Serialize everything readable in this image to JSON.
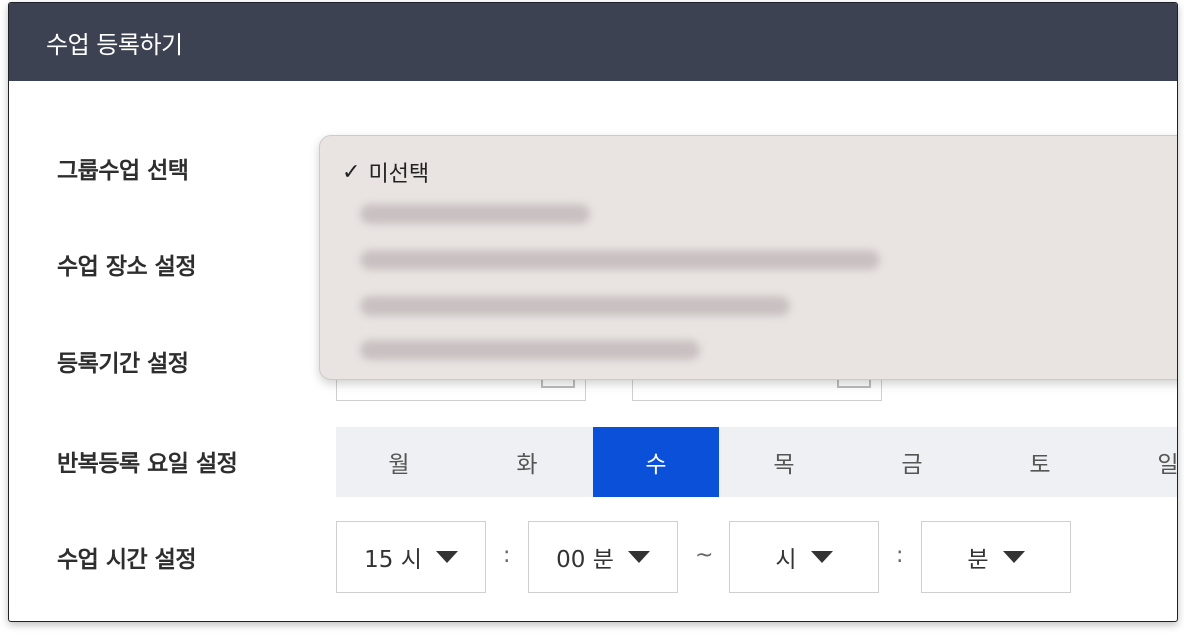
{
  "header": {
    "title": "수업 등록하기"
  },
  "labels": {
    "group": "그룹수업 선택",
    "place": "수업 장소 설정",
    "period": "등록기간 설정",
    "repeat": "반복등록 요일 설정",
    "time": "수업 시간 설정"
  },
  "dropdown": {
    "selected_label": "미선택",
    "check_icon": "✓"
  },
  "days": [
    "월",
    "화",
    "수",
    "목",
    "금",
    "토",
    "일"
  ],
  "active_day": "수",
  "time": {
    "start_hour": "15 시",
    "start_minute": "00 분",
    "end_hour": "시",
    "end_minute": "분",
    "colon": ":",
    "tilde": "~"
  },
  "colors": {
    "header_bg": "#3d4252",
    "accent": "#0a50d9"
  }
}
